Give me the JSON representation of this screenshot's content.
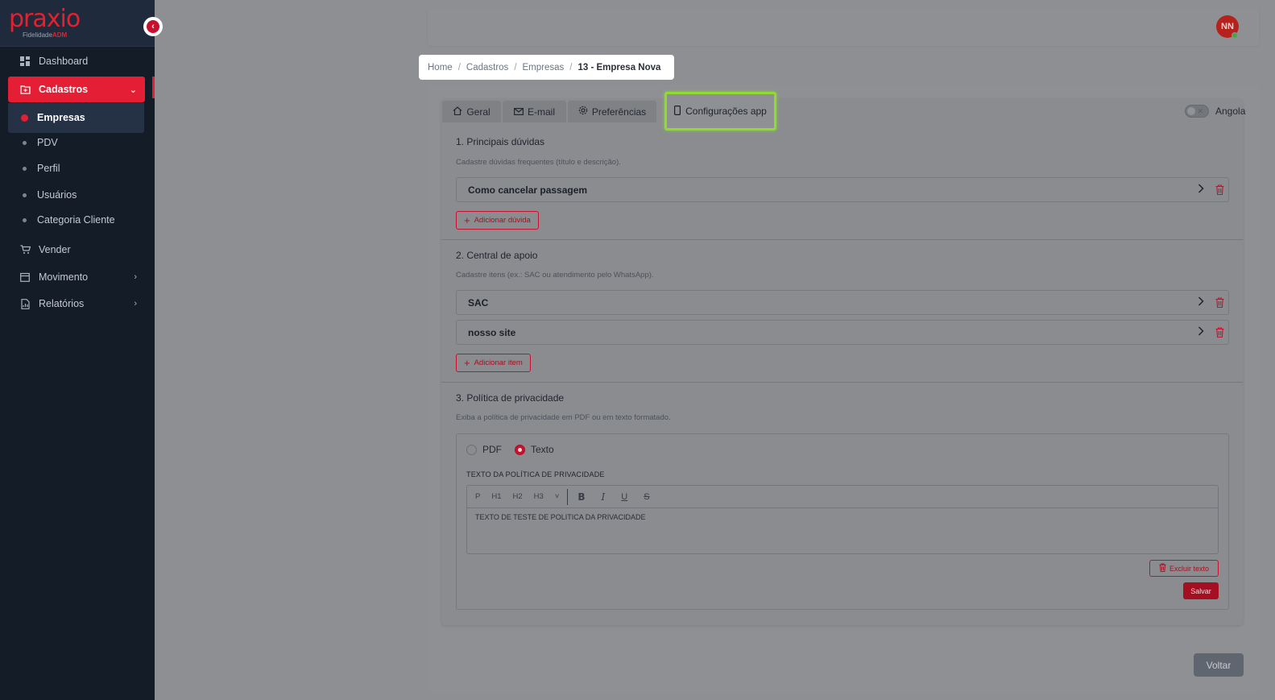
{
  "brand": {
    "logo": "praxio",
    "sub_prefix": "Fidelidade",
    "sub_suffix": "ADM"
  },
  "sidebar": {
    "items": [
      {
        "label": "Dashboard",
        "icon": "dashboard-grid-icon"
      },
      {
        "label": "Cadastros",
        "icon": "folder-plus-icon",
        "chevron": "⌄"
      },
      {
        "label": "Vender",
        "icon": "cart-icon"
      },
      {
        "label": "Movimento",
        "icon": "calendar-icon",
        "chevron": "›"
      },
      {
        "label": "Relatórios",
        "icon": "report-icon",
        "chevron": "›"
      }
    ],
    "subitems": [
      {
        "label": "Empresas"
      },
      {
        "label": "PDV"
      },
      {
        "label": "Perfil"
      },
      {
        "label": "Usuários"
      },
      {
        "label": "Categoria Cliente"
      }
    ]
  },
  "header": {
    "avatar_initials": "NN"
  },
  "breadcrumb": {
    "items": [
      "Home",
      "Cadastros",
      "Empresas"
    ],
    "current": "13 - Empresa Nova",
    "separator": "/"
  },
  "tabs": [
    {
      "label": "Geral",
      "icon": "home-icon"
    },
    {
      "label": "E-mail",
      "icon": "mail-icon"
    },
    {
      "label": "Preferências",
      "icon": "gear-icon"
    },
    {
      "label": "Configurações app",
      "icon": "phone-icon"
    }
  ],
  "country_toggle": {
    "label": "Angola",
    "on": false
  },
  "sections": {
    "duvidas": {
      "title": "1. Principais dúvidas",
      "desc": "Cadastre dúvidas frequentes (título e descrição).",
      "items": [
        "Como cancelar passagem"
      ],
      "add_label": "Adicionar dúvida"
    },
    "apoio": {
      "title": "2. Central de apoio",
      "desc": "Cadastre itens (ex.: SAC ou atendimento pelo WhatsApp).",
      "items": [
        "SAC",
        "nosso site"
      ],
      "add_label": "Adicionar item"
    },
    "privacidade": {
      "title": "3. Política de privacidade",
      "desc": "Exiba a política de privacidade em PDF ou em texto formatado.",
      "radio_pdf": "PDF",
      "radio_texto": "Texto",
      "selected": "Texto",
      "editor_label": "TEXTO DA POLÍTICA DE PRIVACIDADE",
      "toolbar": {
        "p": "P",
        "h1": "H1",
        "h2": "H2",
        "h3": "H3",
        "more": "˅",
        "bold": "B",
        "italic": "I",
        "underline": "U",
        "strike": "S"
      },
      "editor_text": "TEXTO DE TESTE DE POLITICA DA PRIVACIDADE",
      "delete_label": "Excluir texto",
      "save_label": "Salvar"
    }
  },
  "footer": {
    "back_label": "Voltar"
  },
  "colors": {
    "accent": "#e31e35",
    "sidebar_bg": "#141c28",
    "highlight": "#8fdc2f"
  }
}
